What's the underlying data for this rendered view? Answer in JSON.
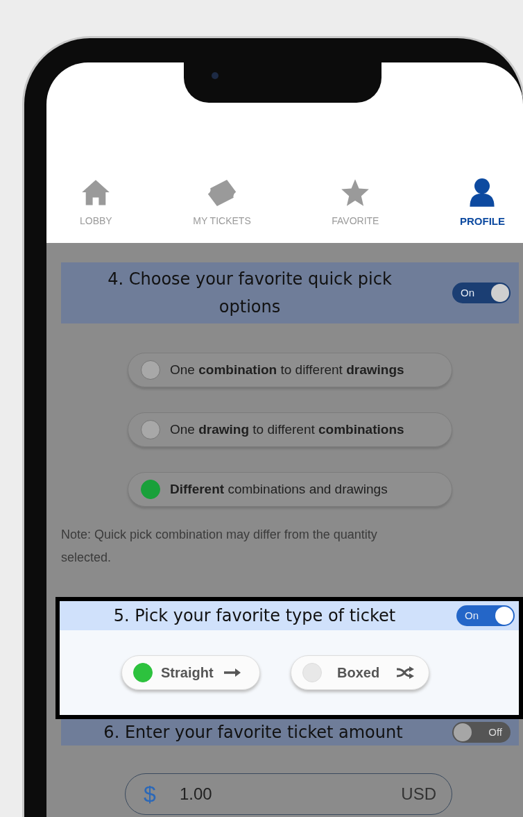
{
  "nav": [
    {
      "label": "LOBBY",
      "selected": false
    },
    {
      "label": "MY TICKETS",
      "selected": false
    },
    {
      "label": "FAVORITE",
      "selected": false
    },
    {
      "label": "PROFILE",
      "selected": true
    }
  ],
  "sections": [
    {
      "kind": "radio-list",
      "highlighted": false,
      "title": "4. Choose your favorite quick pick options",
      "toggle": {
        "on": true,
        "label": "On"
      },
      "options": [
        {
          "label": "One **combination** to different **drawings**",
          "selected": false
        },
        {
          "label": "One **drawing** to different **combinations**",
          "selected": false
        },
        {
          "label": "**Different** combinations and drawings",
          "selected": true
        }
      ],
      "note": "Note: Quick pick combination may differ from the quantity selected."
    },
    {
      "kind": "ticket-type",
      "highlighted": true,
      "title": "5. Pick your favorite type of ticket",
      "toggle": {
        "on": true,
        "label": "On"
      },
      "options": [
        {
          "label": "Straight",
          "selected": true
        },
        {
          "label": "Boxed",
          "selected": false
        }
      ]
    },
    {
      "kind": "amount",
      "highlighted": false,
      "title": "6. Enter your favorite ticket amount",
      "toggle": {
        "on": false,
        "label": "Off"
      },
      "field": {
        "symbol": "$",
        "value": "1.00",
        "currency": "USD"
      }
    }
  ]
}
